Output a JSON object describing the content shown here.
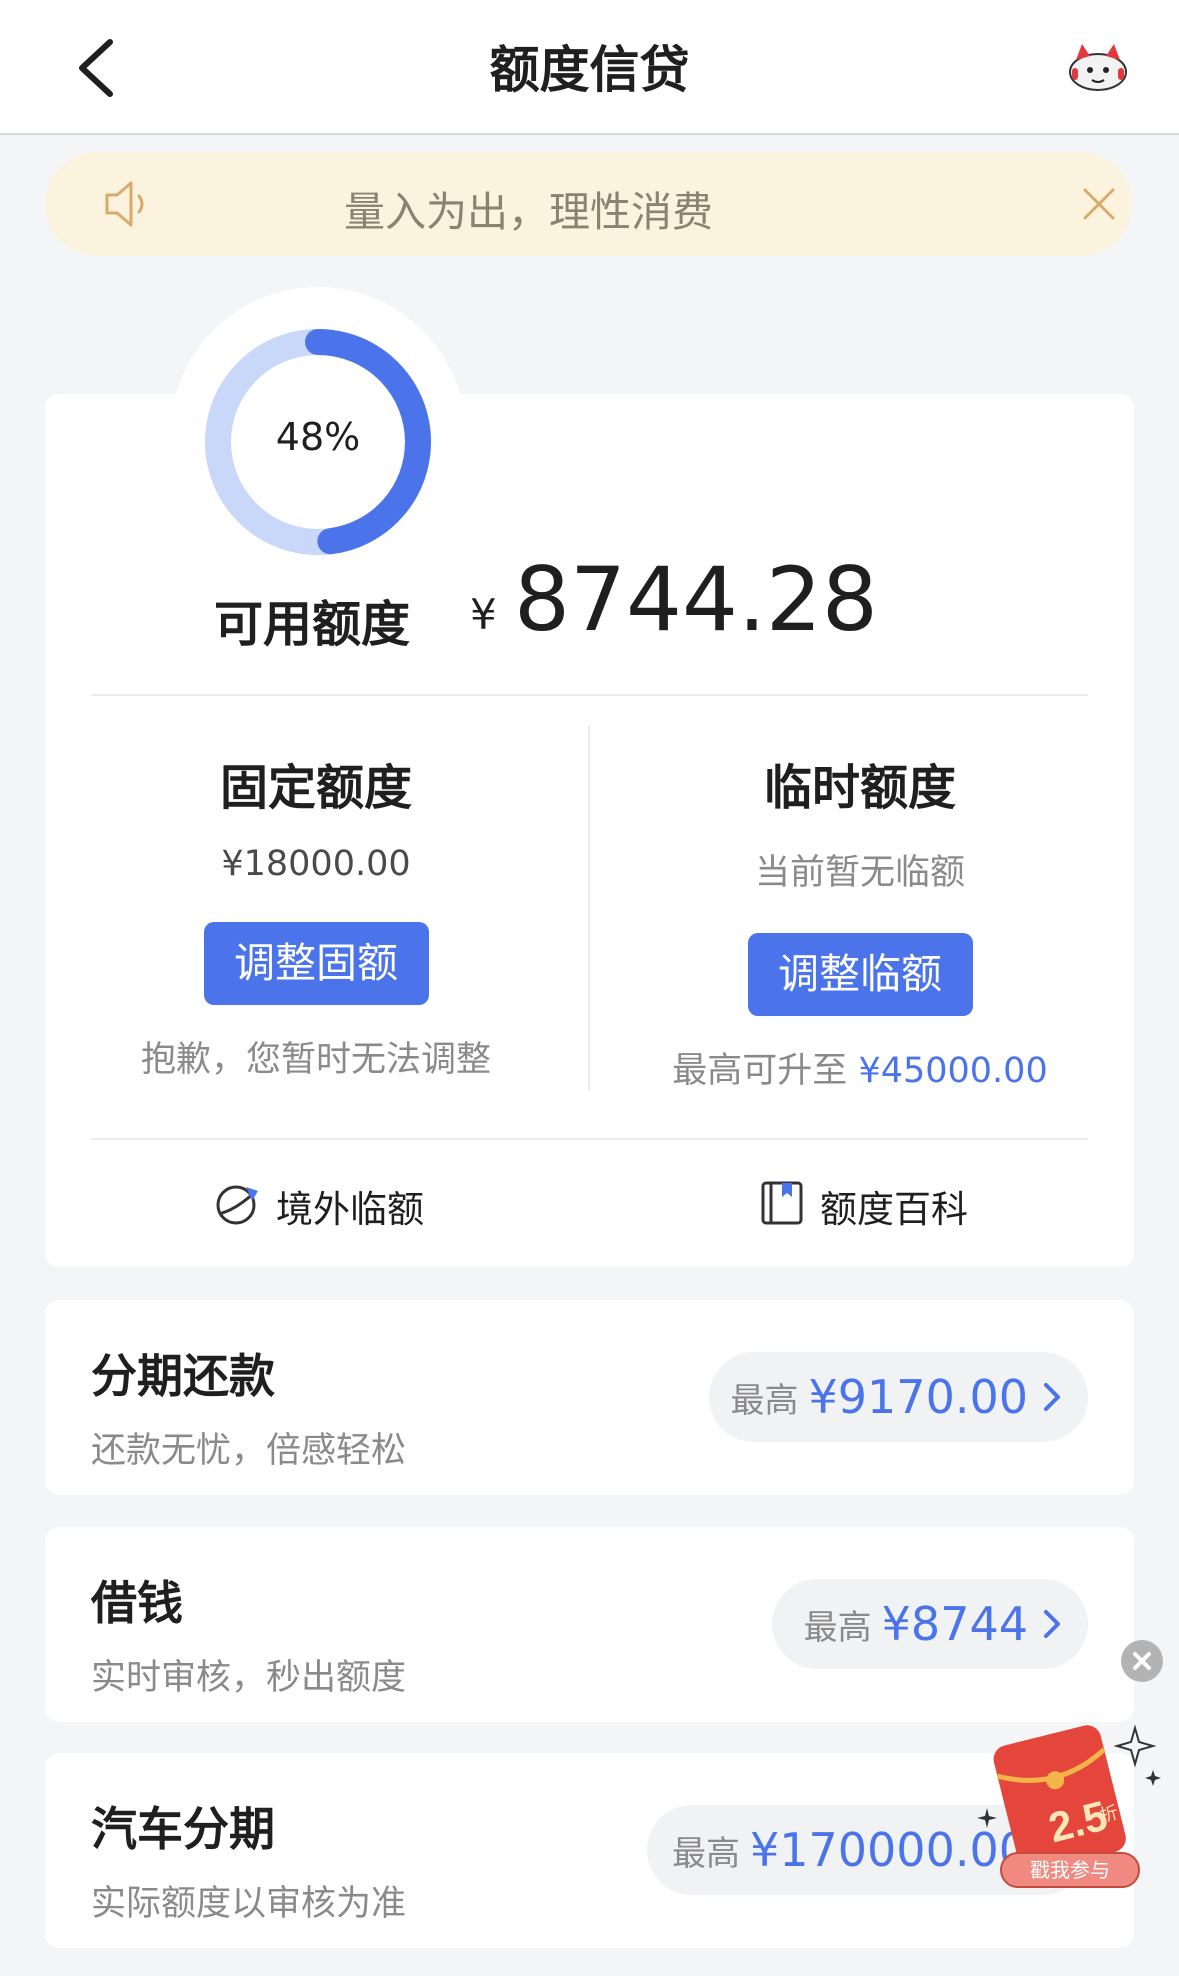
{
  "nav": {
    "title": "额度信贷"
  },
  "notice": {
    "text": "量入为出，理性消费"
  },
  "credit": {
    "usage_percent": 48,
    "usage_label": "48%",
    "available_label": "可用额度",
    "currency": "¥",
    "available_amount": "8744.28",
    "fixed": {
      "title": "固定额度",
      "amount": "¥18000.00",
      "button": "调整固额",
      "note": "抱歉，您暂时无法调整"
    },
    "temporary": {
      "title": "临时额度",
      "status": "当前暂无临额",
      "button": "调整临额",
      "note_prefix": "最高可升至",
      "note_amount": "¥45000.00"
    },
    "links": [
      {
        "label": "境外临额",
        "icon": "overseas-quota-icon"
      },
      {
        "label": "额度百科",
        "icon": "book-icon"
      }
    ]
  },
  "products": [
    {
      "title": "分期还款",
      "subtitle": "还款无忧，倍感轻松",
      "prefix": "最高",
      "amount": "¥9170.00"
    },
    {
      "title": "借钱",
      "subtitle": "实时审核，秒出额度",
      "prefix": "最高",
      "amount": "¥8744"
    },
    {
      "title": "汽车分期",
      "subtitle": "实际额度以审核为准",
      "prefix": "最高",
      "amount": "¥170000.00"
    }
  ],
  "promo": {
    "discount": "2.5",
    "discount_unit": "折",
    "button": "戳我参与"
  },
  "colors": {
    "accent": "#4b74ea",
    "ring_track": "#c9d7f8",
    "notice_bg": "#fbf3dd"
  }
}
